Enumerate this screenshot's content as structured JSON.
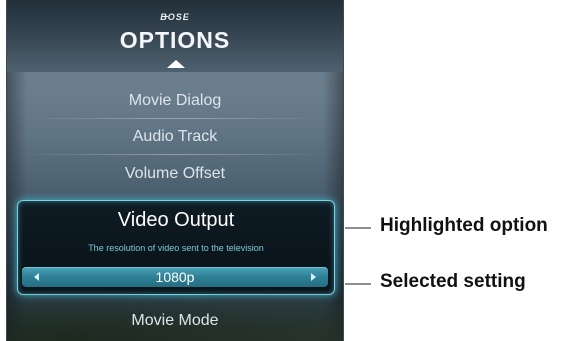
{
  "panel": {
    "brand": "BOSE",
    "title": "OPTIONS",
    "items_above": [
      "Movie Dialog",
      "Audio Track",
      "Volume Offset"
    ],
    "highlighted": {
      "title": "Video Output",
      "description": "The resolution of video sent to the television",
      "value": "1080p"
    },
    "item_below": "Movie Mode"
  },
  "callouts": {
    "highlighted": "Highlighted option",
    "selected": "Selected setting"
  },
  "icons": {
    "scroll_up": "up-arrow-icon",
    "value_prev": "left-arrow-icon",
    "value_next": "right-arrow-icon"
  },
  "colors": {
    "highlight_border": "#7fd1e0",
    "setting_bar": "#2f7f95",
    "description_text": "#7cc9d9"
  }
}
